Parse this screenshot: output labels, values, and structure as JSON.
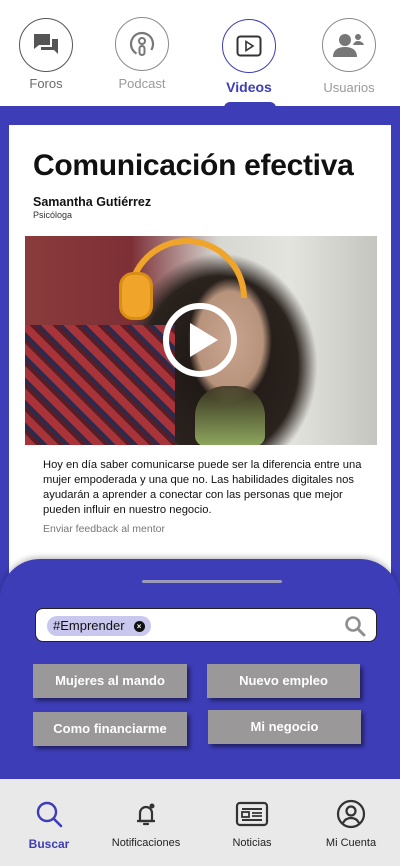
{
  "top_tabs": [
    {
      "label": "Foros",
      "icon": "forum-icon"
    },
    {
      "label": "Podcast",
      "icon": "podcast-icon"
    },
    {
      "label": "Videos",
      "icon": "video-play-icon",
      "active": true
    },
    {
      "label": "Usuarios",
      "icon": "users-icon"
    }
  ],
  "card": {
    "title": "Comunicación efectiva",
    "author": "Samantha Gutiérrez",
    "role": "Psicóloga",
    "description": "Hoy en día saber comunicarse puede ser la diferencia entre una mujer empoderada y una que no. Las habilidades digitales nos ayudarán a aprender a conectar con las personas que mejor pueden influir en nuestro negocio.",
    "feedback": "Enviar feedback al mentor"
  },
  "search": {
    "chip": "#Emprender"
  },
  "categories": [
    "Mujeres al mando",
    "Nuevo empleo",
    "Como financiarme",
    "Mi negocio"
  ],
  "bottom_nav": [
    {
      "label": "Buscar",
      "icon": "search-icon",
      "active": true
    },
    {
      "label": "Notificaciones",
      "icon": "bell-icon"
    },
    {
      "label": "Noticias",
      "icon": "news-icon"
    },
    {
      "label": "Mi Cuenta",
      "icon": "account-icon"
    }
  ],
  "colors": {
    "accent": "#3d3db8",
    "button_gray": "#9a9898",
    "chip_bg": "#c9c7ee"
  }
}
